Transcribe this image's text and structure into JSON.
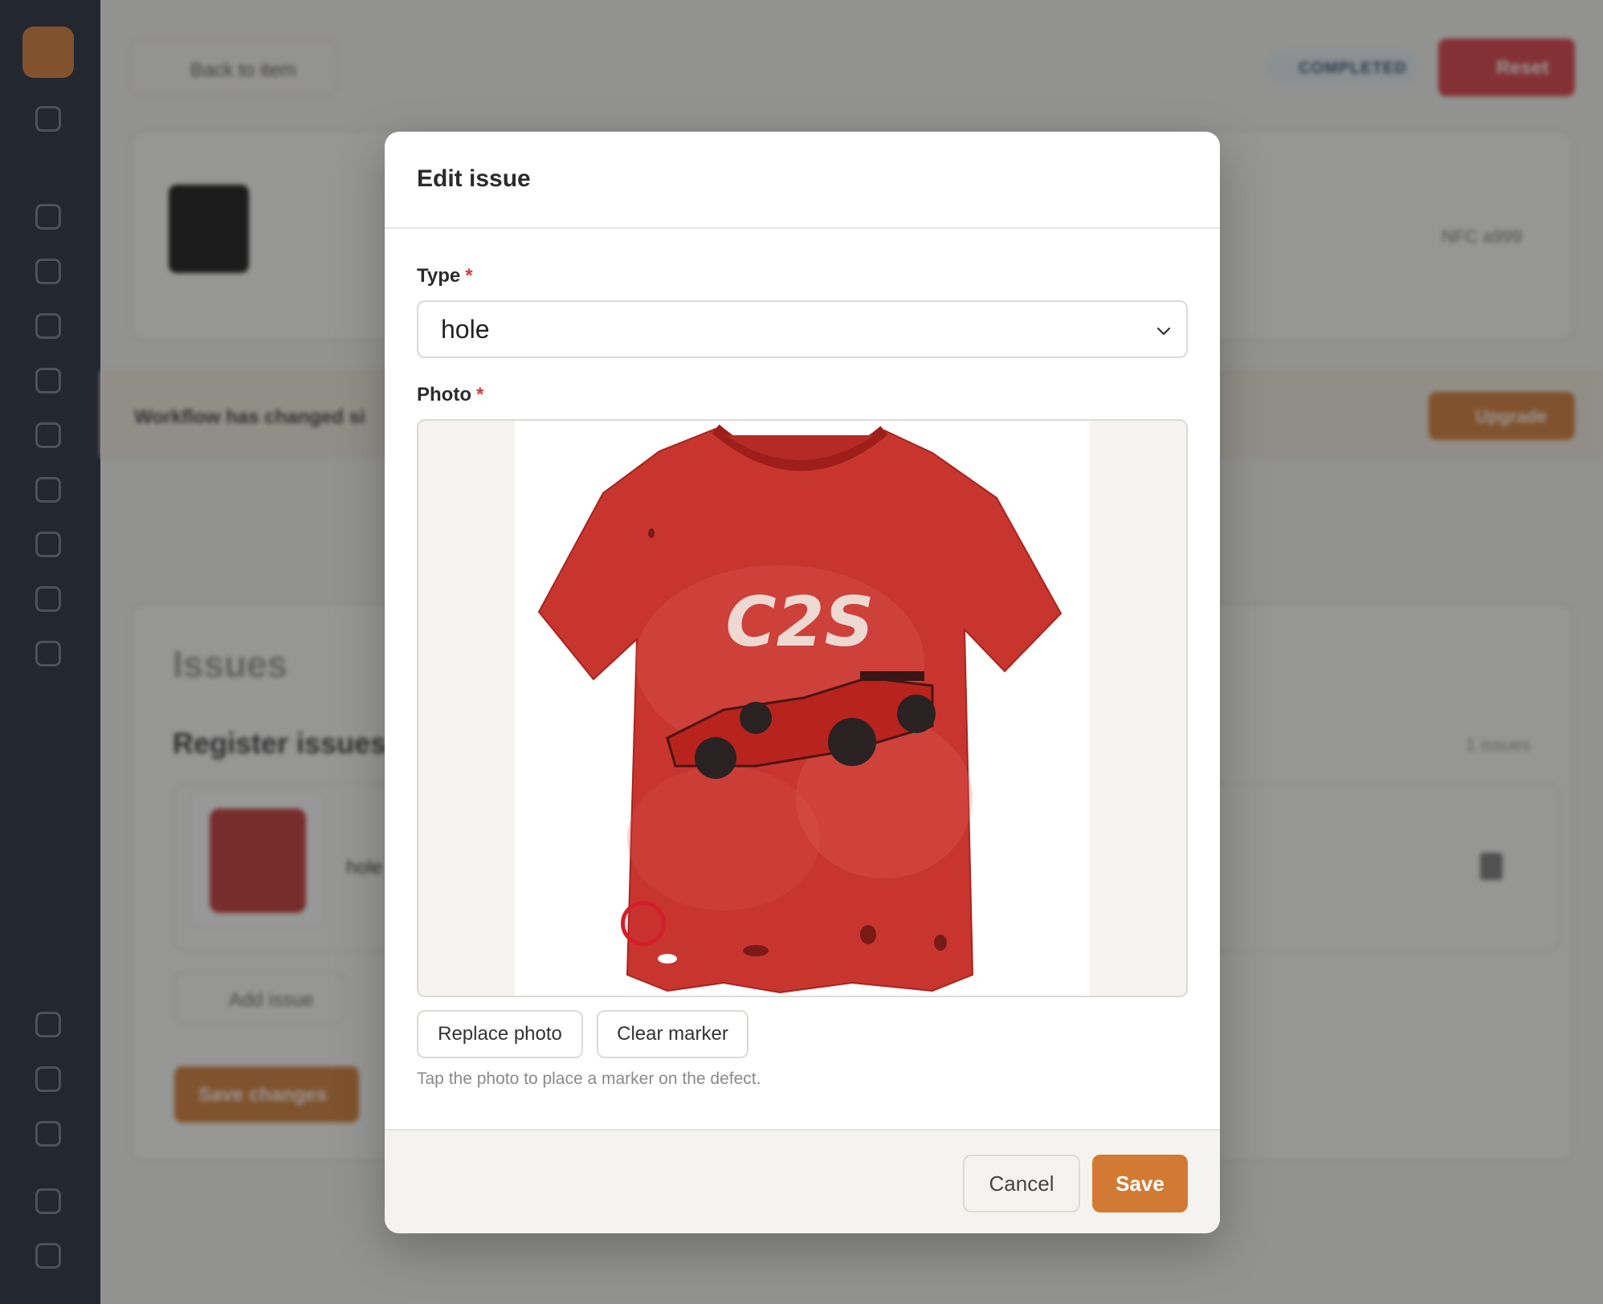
{
  "background": {
    "back_label": "Back to item",
    "status_badge": "COMPLETED",
    "reset_label": "Reset",
    "workflow_banner": "Workflow has changed si",
    "upgrade_label": "Upgrade",
    "issues_heading": "Issues",
    "register_heading": "Register issues",
    "issue_row_type": "hole",
    "issue_count": "1 issues",
    "add_issue_label": "Add issue",
    "save_changes_label": "Save changes",
    "nfc_label": "NFC",
    "nfc_value": "a999"
  },
  "modal": {
    "title": "Edit issue",
    "type_label": "Type",
    "type_required": "*",
    "type_value": "hole",
    "photo_label": "Photo",
    "photo_required": "*",
    "photo_graphic_text": "C2S",
    "replace_photo_label": "Replace photo",
    "clear_marker_label": "Clear marker",
    "hint": "Tap the photo to place a marker on the defect.",
    "cancel_label": "Cancel",
    "save_label": "Save"
  },
  "colors": {
    "accent": "#d27a33",
    "danger": "#d93a41",
    "marker": "#d41f2a",
    "shirt": "#c8352f",
    "sidebar": "#1f2738"
  },
  "icons": [
    "logo-icon",
    "logout-icon",
    "scan-icon",
    "history-icon",
    "calendar-icon",
    "camera-icon",
    "inbox-icon",
    "box-icon",
    "globe-icon",
    "device-icon",
    "user-icon",
    "chevron-down-icon",
    "trash-icon",
    "plus-icon",
    "arrow-left-icon",
    "refresh-icon"
  ]
}
